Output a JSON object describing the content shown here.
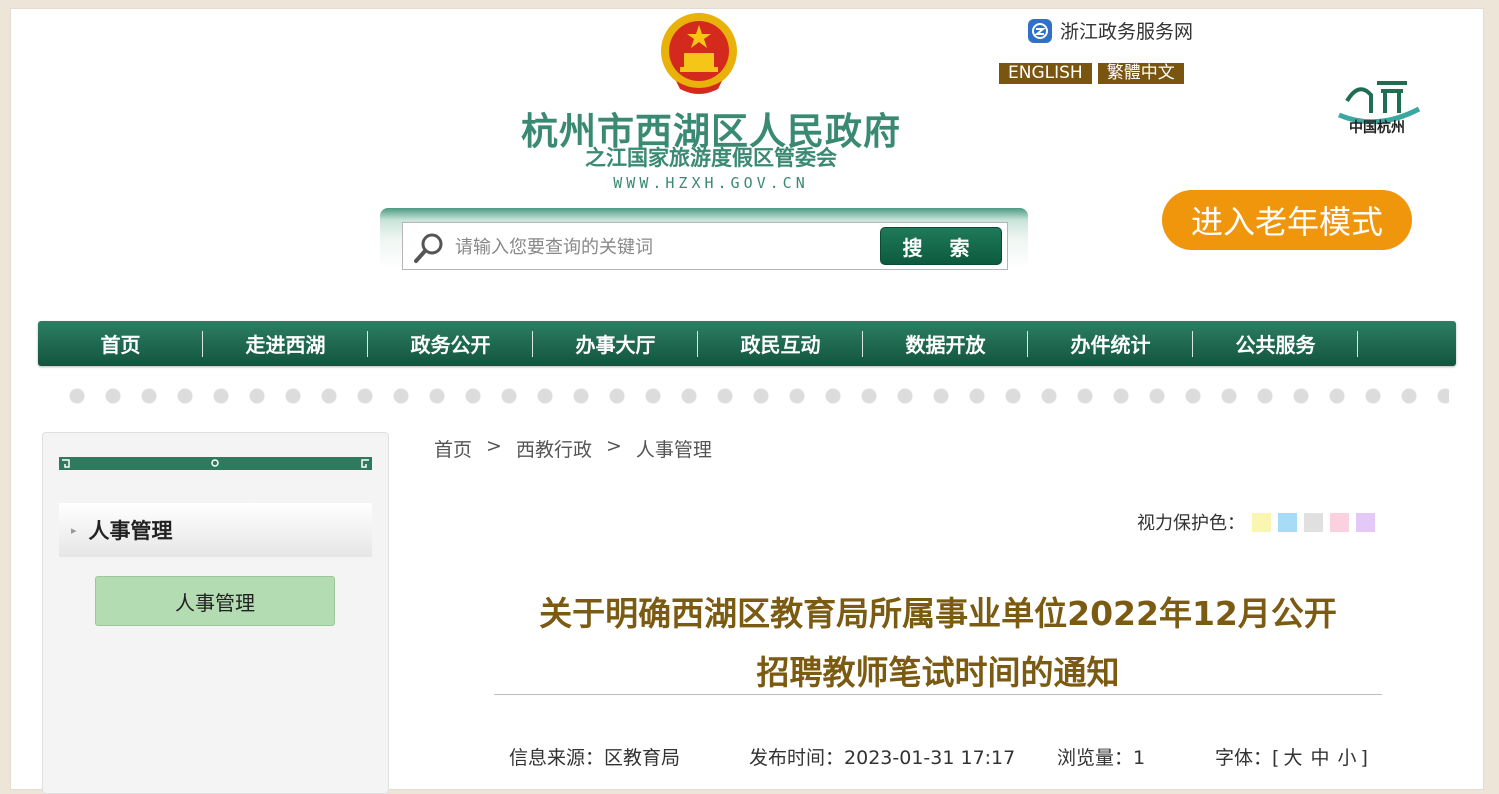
{
  "header": {
    "site_name": "杭州市西湖区人民政府",
    "site_subtitle": "之江国家旅游度假区管委会",
    "site_url": "WWW.HZXH.GOV.CN",
    "zj_portal_label": "浙江政务服务网",
    "lang_english": "ENGLISH",
    "lang_traditional": "繁體中文",
    "hangzhou_logo_text": "中国杭州",
    "elder_mode_label": "进入老年模式"
  },
  "search": {
    "placeholder": "请输入您要查询的关键词",
    "button_label": "搜 索"
  },
  "nav": {
    "items": [
      "首页",
      "走进西湖",
      "政务公开",
      "办事大厅",
      "政民互动",
      "数据开放",
      "办件统计",
      "公共服务"
    ]
  },
  "sidebar": {
    "title": "人事管理",
    "items": [
      "人事管理"
    ]
  },
  "breadcrumb": {
    "items": [
      "首页",
      "西教行政",
      "人事管理"
    ],
    "separator": ">"
  },
  "eye_protection": {
    "label": "视力保护色：",
    "colors": [
      "#faf5b0",
      "#a6dcf5",
      "#e0e0e0",
      "#fbd0df",
      "#e4c8f8"
    ]
  },
  "article": {
    "title_line1": "关于明确西湖区教育局所属事业单位2022年12月公开",
    "title_line2": "招聘教师笔试时间的通知",
    "source_label": "信息来源：",
    "source_value": "区教育局",
    "publish_label": "发布时间：",
    "publish_value": "2023-01-31 17:17",
    "views_label": "浏览量：",
    "views_value": "1",
    "font_label": "字体：",
    "font_open": "[",
    "font_large": "大",
    "font_medium": "中",
    "font_small": "小",
    "font_close": "]"
  },
  "colors": {
    "primary_green": "#1f6e52",
    "title_brown": "#7b5a12",
    "elder_orange": "#f0960c",
    "sidebar_active": "#b4dcb2"
  }
}
